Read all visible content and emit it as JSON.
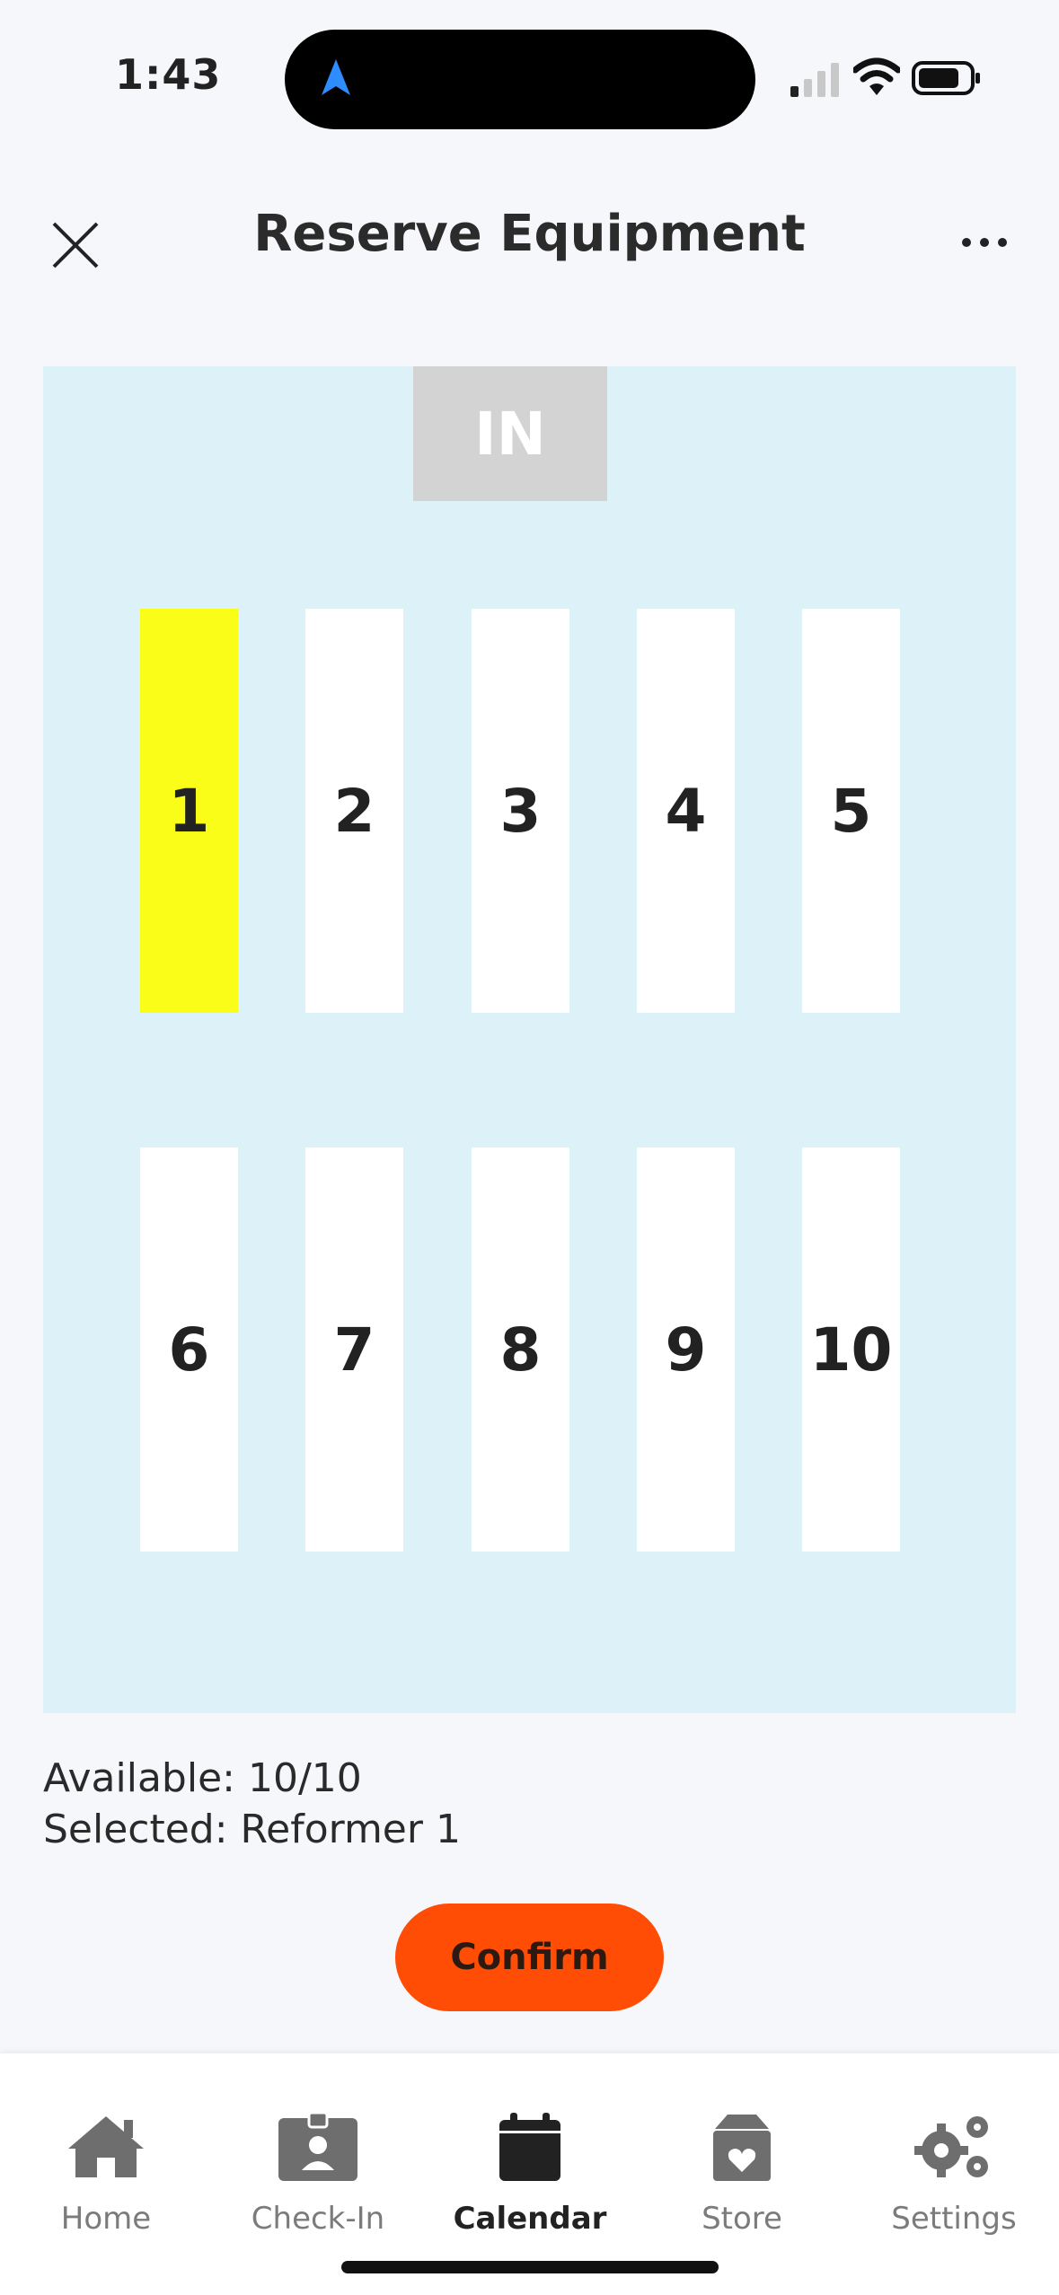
{
  "status_bar": {
    "time": "1:43",
    "icons": [
      "navigation-arrow-icon",
      "signal-icon",
      "wifi-icon",
      "battery-icon"
    ]
  },
  "header": {
    "title": "Reserve Equipment",
    "close_icon": "close-icon",
    "more_icon": "more-icon"
  },
  "floor_map": {
    "entrance_label": "IN",
    "selected_color": "#f9fd18",
    "slots": [
      {
        "label": "1",
        "selected": true
      },
      {
        "label": "2",
        "selected": false
      },
      {
        "label": "3",
        "selected": false
      },
      {
        "label": "4",
        "selected": false
      },
      {
        "label": "5",
        "selected": false
      },
      {
        "label": "6",
        "selected": false
      },
      {
        "label": "7",
        "selected": false
      },
      {
        "label": "8",
        "selected": false
      },
      {
        "label": "9",
        "selected": false
      },
      {
        "label": "10",
        "selected": false
      }
    ]
  },
  "summary": {
    "available": "Available: 10/10",
    "selected": "Selected: Reformer 1"
  },
  "actions": {
    "confirm_label": "Confirm",
    "confirm_color": "#ff4d05"
  },
  "tab_bar": {
    "tabs": [
      {
        "label": "Home",
        "icon": "home-icon",
        "active": false
      },
      {
        "label": "Check-In",
        "icon": "id-badge-icon",
        "active": false
      },
      {
        "label": "Calendar",
        "icon": "calendar-icon",
        "active": true
      },
      {
        "label": "Store",
        "icon": "gift-box-icon",
        "active": false
      },
      {
        "label": "Settings",
        "icon": "gears-icon",
        "active": false
      }
    ]
  }
}
